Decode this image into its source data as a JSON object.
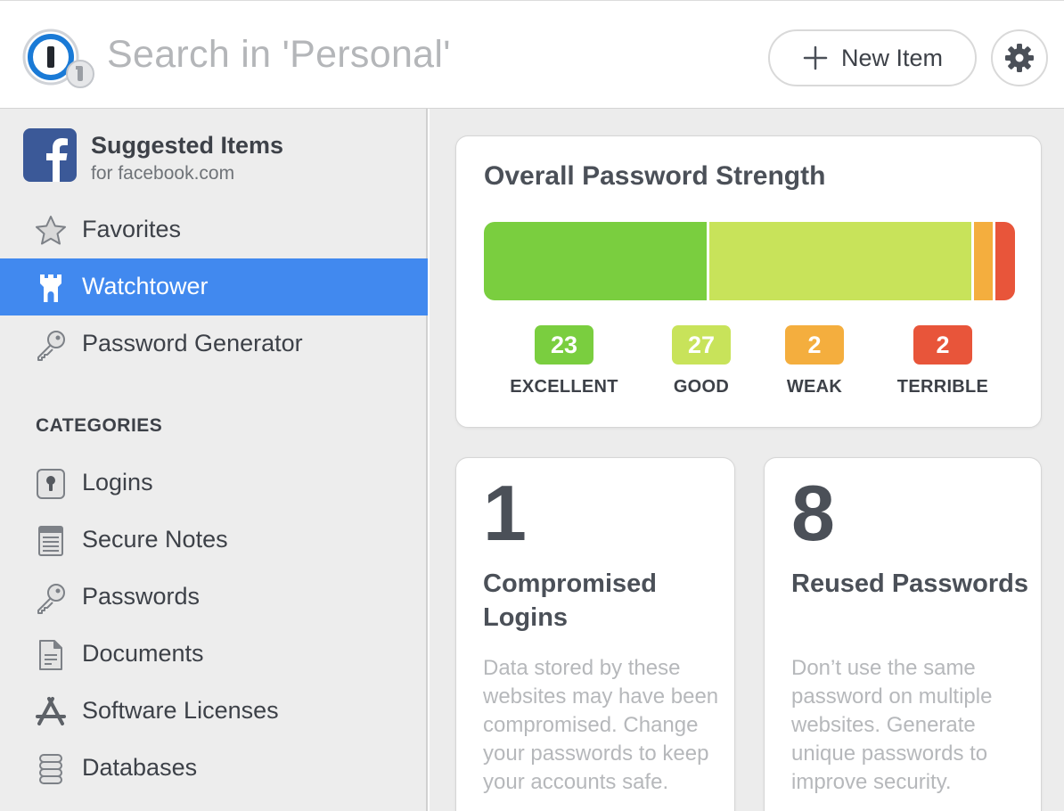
{
  "header": {
    "search_placeholder": "Search in 'Personal'",
    "new_item_label": "New Item"
  },
  "sidebar": {
    "suggested": {
      "title": "Suggested Items",
      "subtitle": "for facebook.com"
    },
    "top_items": [
      {
        "label": "Favorites",
        "icon": "star-icon"
      },
      {
        "label": "Watchtower",
        "icon": "watchtower-icon",
        "active": true
      },
      {
        "label": "Password Generator",
        "icon": "key-icon"
      }
    ],
    "categories_heading": "CATEGORIES",
    "categories": [
      {
        "label": "Logins",
        "icon": "login-lock-icon"
      },
      {
        "label": "Secure Notes",
        "icon": "notes-icon"
      },
      {
        "label": "Passwords",
        "icon": "key-icon"
      },
      {
        "label": "Documents",
        "icon": "document-icon"
      },
      {
        "label": "Software Licenses",
        "icon": "app-store-icon"
      },
      {
        "label": "Databases",
        "icon": "database-icon"
      }
    ]
  },
  "main": {
    "strength": {
      "title": "Overall Password Strength",
      "levels": [
        {
          "label": "EXCELLENT",
          "count": "23",
          "color": "#7ace3f"
        },
        {
          "label": "GOOD",
          "count": "27",
          "color": "#c8e35a"
        },
        {
          "label": "WEAK",
          "count": "2",
          "color": "#f4ae3e"
        },
        {
          "label": "TERRIBLE",
          "count": "2",
          "color": "#e8553a"
        }
      ]
    },
    "cards": [
      {
        "number": "1",
        "title": "Compromised Logins",
        "description": "Data stored by these websites may have been compromised. Change your passwords to keep your accounts safe."
      },
      {
        "number": "8",
        "title": "Reused Passwords",
        "description": "Don’t use the same password on multiple websites. Generate unique passwords to improve security."
      }
    ]
  },
  "colors": {
    "accent": "#4189ef",
    "sidebar_bg": "#ededed",
    "facebook": "#3b5998"
  }
}
